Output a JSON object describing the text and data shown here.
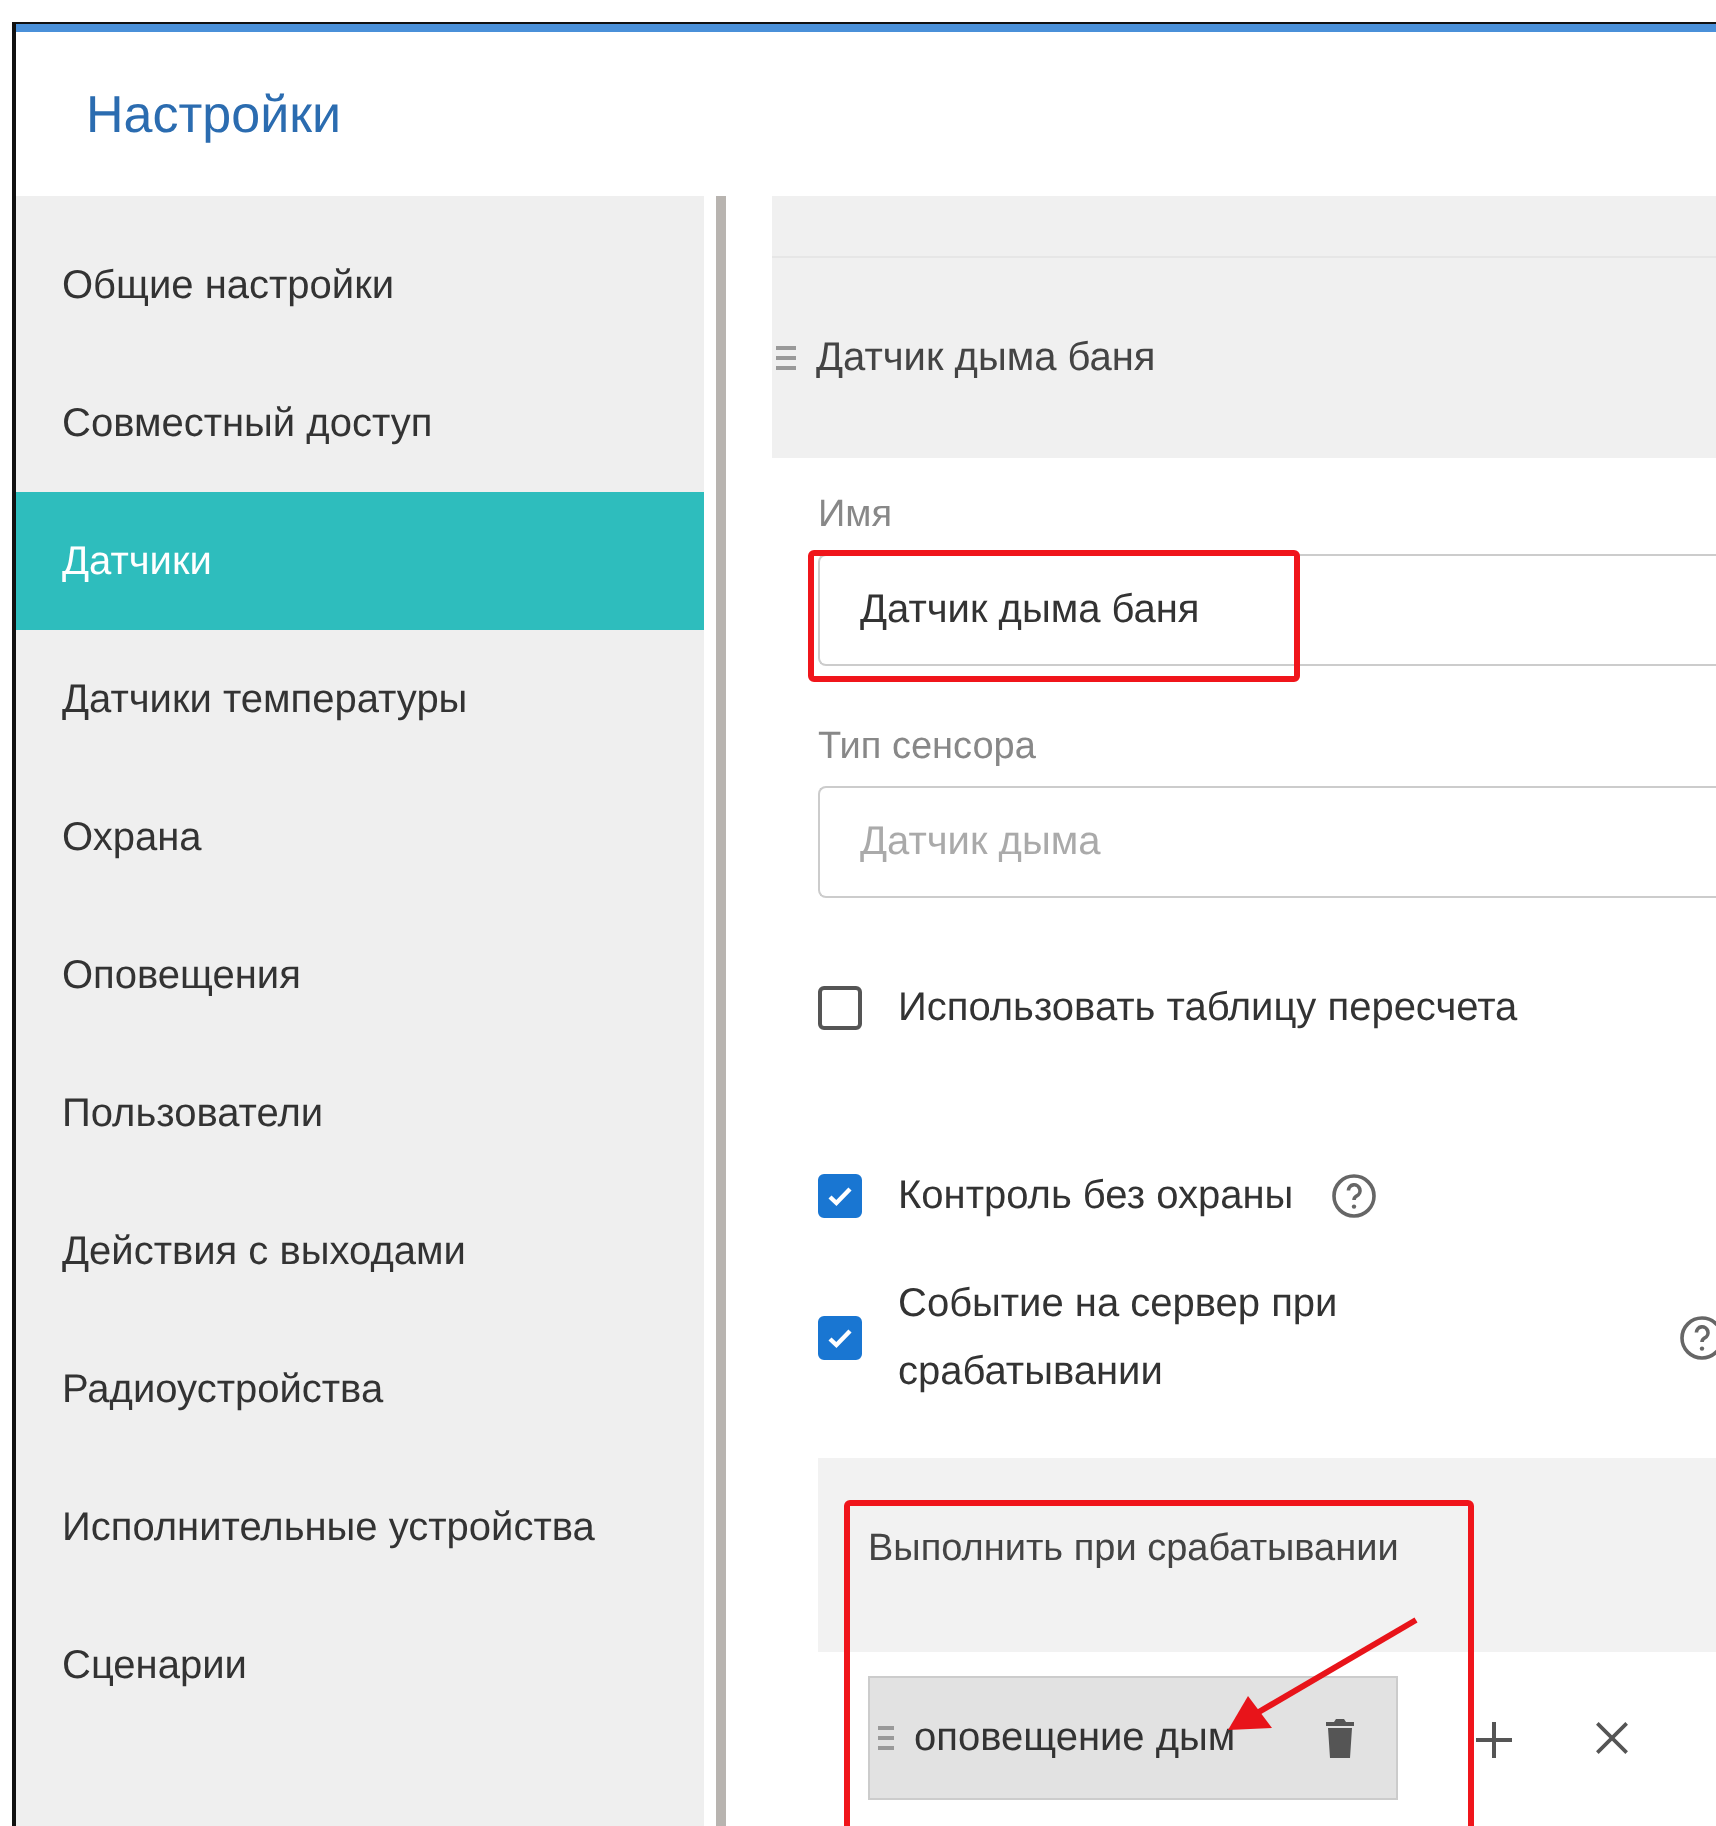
{
  "window": {
    "title": "Настройки"
  },
  "sidebar": {
    "items": [
      {
        "label": "Общие настройки",
        "selected": false
      },
      {
        "label": "Совместный доступ",
        "selected": false
      },
      {
        "label": "Датчики",
        "selected": true
      },
      {
        "label": "Датчики температуры",
        "selected": false
      },
      {
        "label": "Охрана",
        "selected": false
      },
      {
        "label": "Оповещения",
        "selected": false
      },
      {
        "label": "Пользователи",
        "selected": false
      },
      {
        "label": "Действия с выходами",
        "selected": false
      },
      {
        "label": "Радиоустройства",
        "selected": false
      },
      {
        "label": "Исполнительные устройства",
        "selected": false
      },
      {
        "label": "Сценарии",
        "selected": false
      }
    ]
  },
  "sensor": {
    "title": "Датчик дыма баня",
    "name_field": {
      "label": "Имя",
      "value": "Датчик дыма баня"
    },
    "type_field": {
      "label": "Тип сенсора",
      "placeholder": "Датчик дыма"
    },
    "options": [
      {
        "label": "Использовать таблицу пересчета",
        "checked": false,
        "help": false
      },
      {
        "label": "Контроль без охраны",
        "checked": true,
        "help": true
      },
      {
        "label": "Событие на сервер при срабатывании",
        "checked": true,
        "help": true
      }
    ],
    "actions": {
      "title": "Выполнить при срабатывании",
      "items": [
        {
          "label": "оповещение дым"
        }
      ]
    }
  }
}
